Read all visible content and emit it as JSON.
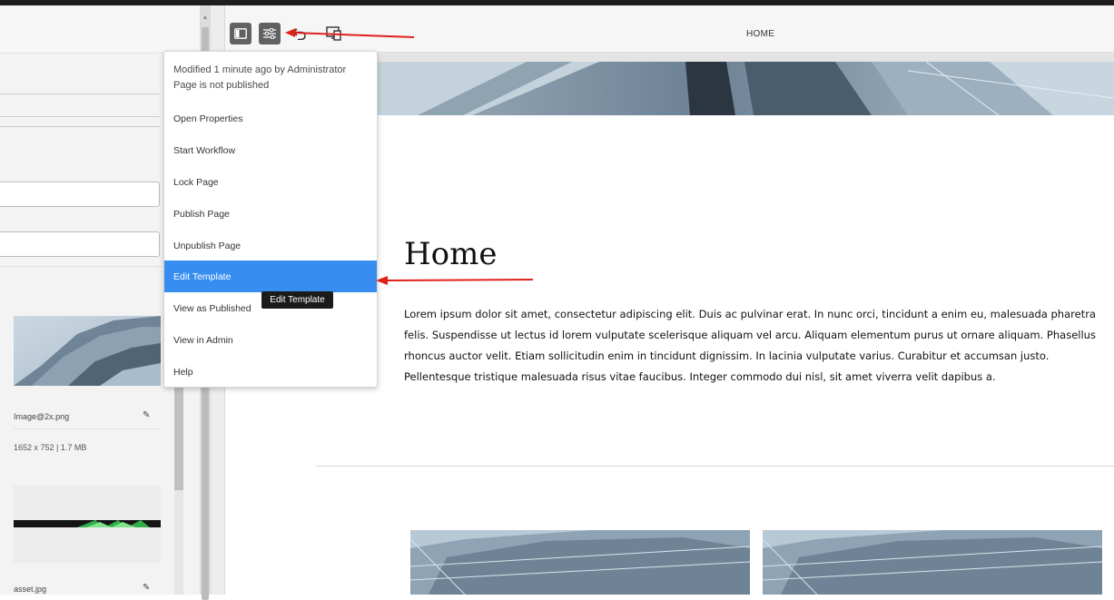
{
  "toolbar": {
    "page_title": "HOME"
  },
  "page_info_menu": {
    "modified": "Modified 1 minute ago by Administrator",
    "status": "Page is not published",
    "items": [
      {
        "label": "Open Properties"
      },
      {
        "label": "Start Workflow"
      },
      {
        "label": "Lock Page"
      },
      {
        "label": "Publish Page"
      },
      {
        "label": "Unpublish Page"
      },
      {
        "label": "Edit Template",
        "highlighted": true
      },
      {
        "label": "View as Published"
      },
      {
        "label": "View in Admin"
      },
      {
        "label": "Help"
      }
    ],
    "tooltip": "Edit Template"
  },
  "page": {
    "heading": "Home",
    "body": "Lorem ipsum dolor sit amet, consectetur adipiscing elit. Duis ac pulvinar erat. In nunc orci, tincidunt a enim eu, malesuada pharetra felis. Suspendisse ut lectus id lorem vulputate scelerisque aliquam vel arcu. Aliquam elementum purus ut ornare aliquam. Phasellus rhoncus auctor velit. Etiam sollicitudin enim in tincidunt dignissim. In lacinia vulputate varius. Curabitur et accumsan justo. Pellentesque tristique malesuada risus vitae faucibus. Integer commodo dui nisl, sit amet viverra velit dapibus a."
  },
  "assets": [
    {
      "name": "Image@2x.png",
      "meta": "1652 x 752 | 1.7 MB"
    },
    {
      "name": "asset.jpg"
    }
  ],
  "colors": {
    "highlight": "#378ef0",
    "annotation_arrow": "#e0201b",
    "toolbar_button": "#616161"
  },
  "icons": {
    "side_panel_toggle": "side-panel-icon",
    "page_information": "sliders-icon",
    "undo": "undo-icon",
    "emulator": "device-emulator-icon",
    "edit": "pencil-icon"
  }
}
